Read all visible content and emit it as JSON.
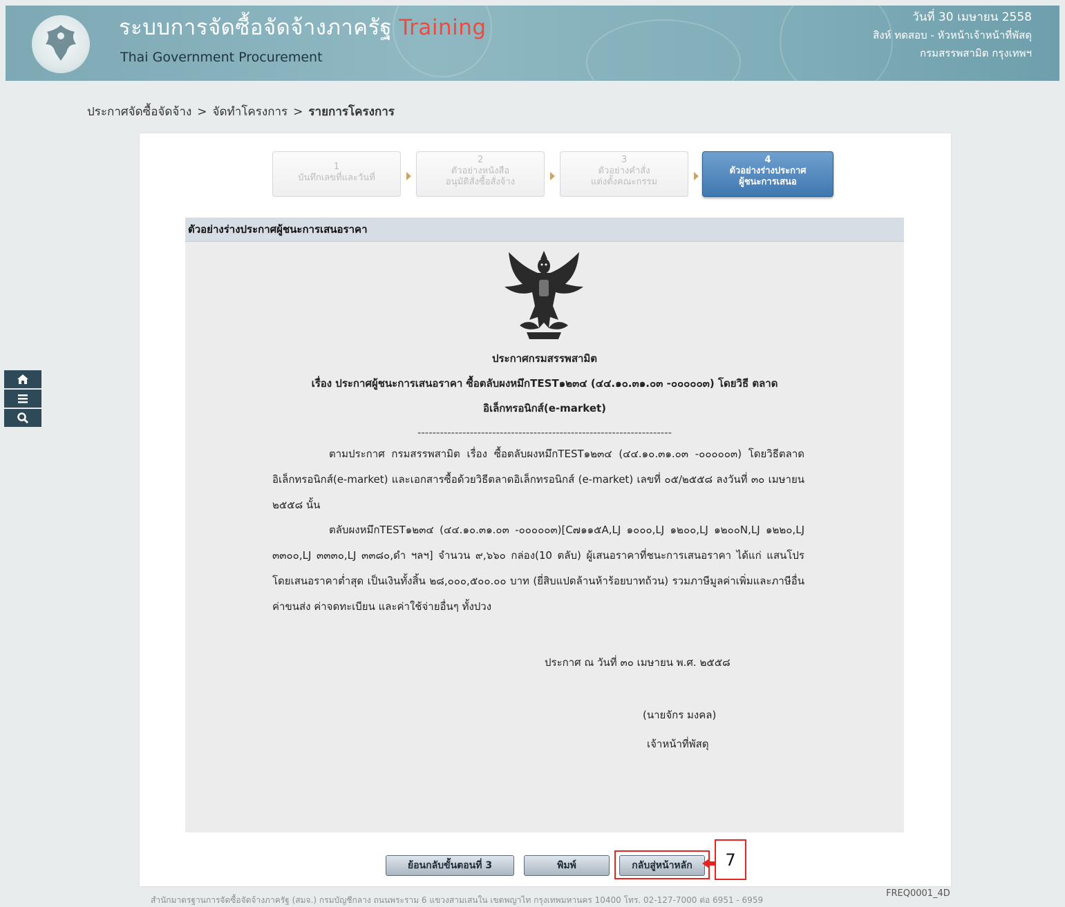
{
  "header": {
    "title": "ระบบการจัดซื้อจัดจ้างภาครัฐ",
    "training_label": "Training",
    "subtitle": "Thai Government Procurement",
    "date": "วันที่ 30 เมษายน 2558",
    "user": "สิงห์ ทดสอบ - หัวหน้าเจ้าหน้าที่พัสดุ",
    "department": "กรมสรรพสามิต กรุงเทพฯ",
    "logo_icon": "garuda-logo-icon"
  },
  "breadcrumb": {
    "item1": "ประกาศจัดซื้อจัดจ้าง",
    "item2": "จัดทำโครงการ",
    "item3": "รายการโครงการ",
    "separator": ">"
  },
  "sidenav": {
    "icons": [
      "home-icon",
      "menu-icon",
      "search-icon"
    ]
  },
  "stepper": {
    "steps": [
      {
        "num": "1",
        "line1": "บันทึกเลขที่และวันที่",
        "line2": ""
      },
      {
        "num": "2",
        "line1": "ตัวอย่างหนังสือ",
        "line2": "อนุมัติสั่งซื้อสั่งจ้าง"
      },
      {
        "num": "3",
        "line1": "ตัวอย่างคำสั่ง",
        "line2": "แต่งตั้งคณะกรรม"
      },
      {
        "num": "4",
        "line1": "ตัวอย่างร่างประกาศ",
        "line2": "ผู้ชนะการเสนอ"
      }
    ],
    "active_step": 4
  },
  "document": {
    "section_title": "ตัวอย่างร่างประกาศผู้ชนะการเสนอราคา",
    "org_heading": "ประกาศกรมสรรพสามิต",
    "subject_line1": "เรื่อง ประกาศผู้ชนะการเสนอราคา ซื้อตลับผงหมึกTEST๑๒๓๔ (๔๔.๑๐.๓๑.๐๓ -๐๐๐๐๐๓) โดยวิธี ตลาด",
    "subject_line2": "อิเล็กทรอนิกส์(e-market)",
    "divider": "--------------------------------------------------------------------",
    "para1": "ตามประกาศ กรมสรรพสามิต เรื่อง ซื้อตลับผงหมึกTEST๑๒๓๔ (๔๔.๑๐.๓๑.๐๓ -๐๐๐๐๐๓) โดยวิธีตลาดอิเล็กทรอนิกส์(e-market) และเอกสารซื้อด้วยวิธีตลาดอิเล็กทรอนิกส์ (e-market) เลขที่ ๐๕/๒๕๕๘ ลงวันที่ ๓๐ เมษายน ๒๕๕๘ นั้น",
    "para2": "ตลับผงหมึกTEST๑๒๓๔ (๔๔.๑๐.๓๑.๐๓ -๐๐๐๐๐๓)[C๗๑๑๕A,LJ ๑๐๐๐,LJ ๑๒๐๐,LJ ๑๒๐๐N,LJ ๑๒๒๐,LJ ๓๓๐๐,LJ ๓๓๓๐,LJ ๓๓๘๐,ดำ ฯลฯ] จำนวน ๙,๖๖๐ กล่อง(10 ตลับ) ผู้เสนอราคาที่ชนะการเสนอราคา ได้แก่ แสนโปร โดยเสนอราคาต่ำสุด เป็นเงินทั้งสิ้น ๒๘,๐๐๐,๕๐๐.๐๐ บาท (ยี่สิบแปดล้านห้าร้อยบาทถ้วน) รวมภาษีมูลค่าเพิ่มและภาษีอื่น ค่าขนส่ง ค่าจดทะเบียน และค่าใช้จ่ายอื่นๆ ทั้งปวง",
    "announce_date": "ประกาศ ณ วันที่ ๓๐ เมษายน พ.ศ. ๒๕๕๘",
    "signer_name": "(นายจักร มงคล)",
    "signer_position": "เจ้าหน้าที่พัสดุ"
  },
  "buttons": {
    "back": "ย้อนกลับขั้นตอนที่ 3",
    "print": "พิมพ์",
    "home": "กลับสู่หน้าหลัก"
  },
  "callout": "7",
  "footer": {
    "text": "สำนักมาตรฐานการจัดซื้อจัดจ้างภาครัฐ (สมจ.) กรมบัญชีกลาง ถนนพระราม 6 แขวงสามเสนใน เขตพญาไท กรุงเทพมหานคร 10400 โทร. 02-127-7000 ต่อ 6951 - 6959",
    "page_code": "FREQ0001_4D"
  },
  "colors": {
    "header_bg": "#8fb8c2",
    "training": "#f04a3c",
    "active_step": "#3f78b0",
    "highlight": "#e52420"
  }
}
